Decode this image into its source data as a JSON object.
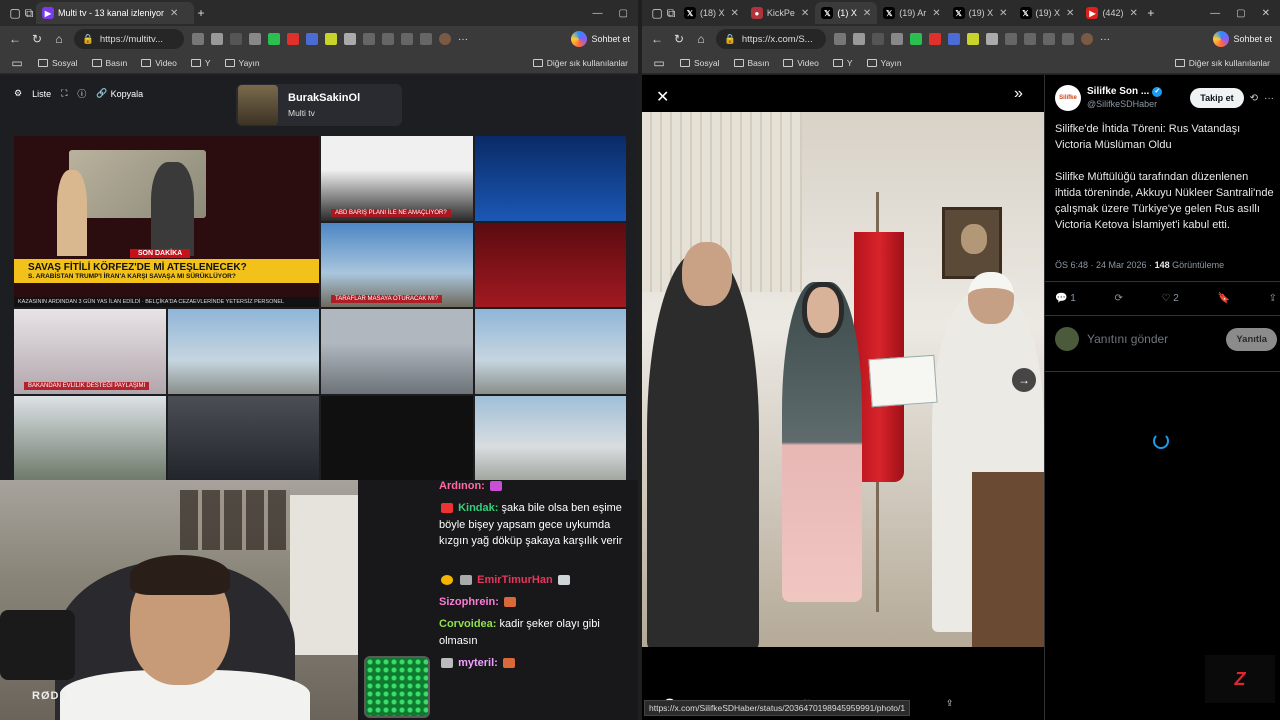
{
  "left": {
    "tabs": [
      {
        "label": "Multi tv - 13 kanal izleniyor",
        "active": true,
        "color": "#7c3aed"
      }
    ],
    "url": "https://multitv...",
    "bookmarks": [
      "Sosyal",
      "Basın",
      "Video",
      "Y",
      "Yayın"
    ],
    "bookmarks_other": "Diğer sık kullanılanlar",
    "copilot_label": "Sohbet et",
    "toolbar": {
      "list_label": "Liste",
      "copy_label": "Kopyala"
    },
    "channel": {
      "name": "BurakSakinOl",
      "sub": "Multi tv"
    },
    "tiles": {
      "big_sondakika": "SON DAKİKA",
      "big_headline": "SAVAŞ FİTİLİ KÖRFEZ'DE Mİ ATEŞLENECEK?",
      "big_subline": "S. ARABİSTAN TRUMP'I İRAN'A KARŞI SAVAŞA MI SÜRÜKLÜYOR?",
      "big_ticker": "KAZASININ ARDINDAN 3 GÜN YAS İLAN EDİLDİ · BELÇİKA'DA CEZAEVLERİNDE YETERSİZ PERSONEL",
      "abd_label": "ABD BARIŞ PLANI İLE NE AMAÇLIYOR?",
      "taraflar_label": "TARAFLAR MASAYA OTURACAK MI?",
      "bakan_label": "BAKANDAN EVLİLİK DESTEĞİ PAYLAŞIMI"
    },
    "chat": [
      {
        "user": "Ardınon:",
        "text": "",
        "color": "#ff6aa2"
      },
      {
        "user": "Kindak:",
        "text": "şaka bile olsa ben eşime böyle bişey yapsam gece uykumda kızgın yağ döküp şakaya karşılık verir",
        "color": "#33d17a"
      },
      {
        "user": "EmirTimurHan",
        "text": "",
        "color": "#e8355a"
      },
      {
        "user": "Sizophrein:",
        "text": "",
        "color": "#ff7ad6"
      },
      {
        "user": "Corvoidea:",
        "text": "kadir şeker olayı gibi olmasın",
        "color": "#8fe04a"
      },
      {
        "user": "myteril:",
        "text": "",
        "color": "#f2a0ff"
      }
    ],
    "webcam_mic_brand": "RØDE"
  },
  "right": {
    "tabs": [
      {
        "label": "(18) X",
        "active": false,
        "icon": "X"
      },
      {
        "label": "KickPe",
        "active": false,
        "icon": "K"
      },
      {
        "label": "(1) X",
        "active": true,
        "icon": "X"
      },
      {
        "label": "(19) Ar",
        "active": false,
        "icon": "X"
      },
      {
        "label": "(19) X",
        "active": false,
        "icon": "X"
      },
      {
        "label": "(19) X",
        "active": false,
        "icon": "X"
      },
      {
        "label": "(442)",
        "active": false,
        "icon": "Y"
      }
    ],
    "url": "https://x.com/S...",
    "bookmarks": [
      "Sosyal",
      "Basın",
      "Video",
      "Y",
      "Yayın"
    ],
    "bookmarks_other": "Diğer sık kullanılanlar",
    "copilot_label": "Sohbet et",
    "status_url": "https://x.com/SilifkeSDHaber/status/2036470198945959991/photo/1",
    "bottom_views": "148",
    "tweet": {
      "name": "Silifke Son ...",
      "handle": "@SilifkeSDHaber",
      "avatar_text": "Silifke",
      "follow_label": "Takip et",
      "title": "Silifke'de İhtida Töreni: Rus Vatandaşı Victoria Müslüman Oldu",
      "body": "Silifke Müftülüğü tarafından düzenlenen ihtida töreninde, Akkuyu Nükleer Santrali'nde çalışmak üzere Türkiye'ye gelen Rus asıllı Victoria Ketova İslamiyet'i kabul etti.",
      "time": "ÖS 6:48 · 24 Mar 2026 · ",
      "views": "148",
      "views_label": " Görüntüleme",
      "replies": "1",
      "likes": "2",
      "reply_placeholder": "Yanıtını gönder",
      "reply_button": "Yanıtla"
    }
  }
}
